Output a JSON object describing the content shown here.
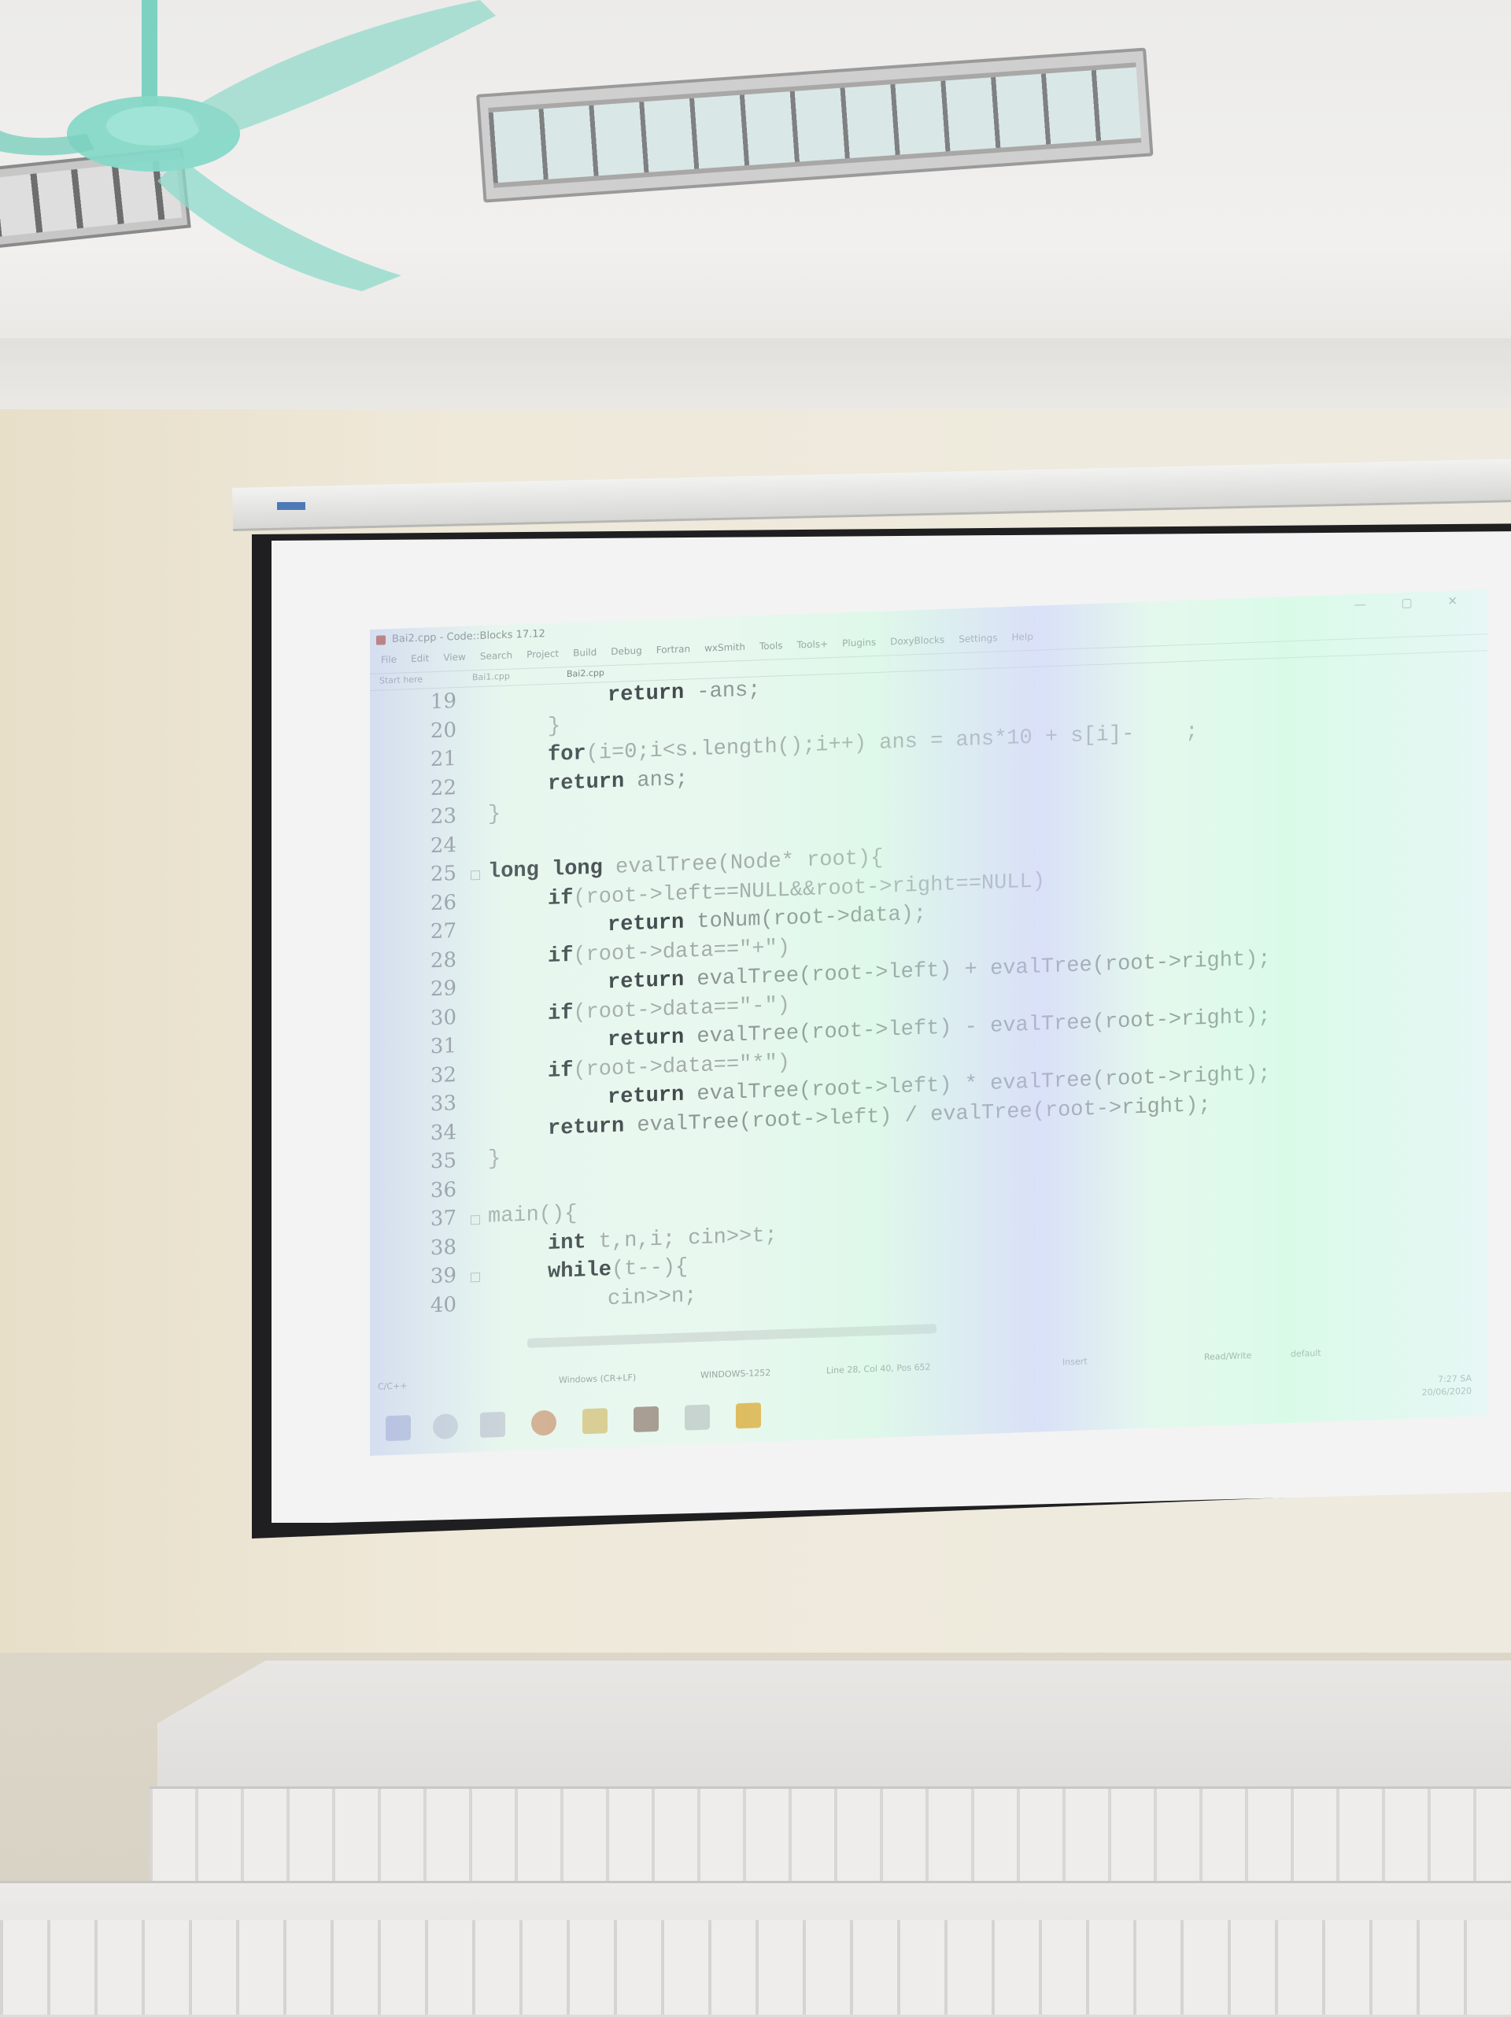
{
  "ide": {
    "window_title": "Bai2.cpp - Code::Blocks 17.12",
    "window_controls": "— ▢ ✕",
    "menu": [
      "File",
      "Edit",
      "View",
      "Search",
      "Project",
      "Build",
      "Debug",
      "Fortran",
      "wxSmith",
      "Tools",
      "Tools+",
      "Plugins",
      "DoxyBlocks",
      "Settings",
      "Help"
    ],
    "tabs": [
      "Start here",
      "Bai1.cpp",
      "Bai2.cpp"
    ],
    "code_lines": [
      {
        "n": "19",
        "indent": 2,
        "parts": [
          {
            "k": "kw",
            "t": "return"
          },
          {
            "k": "txt",
            "t": " -ans;"
          }
        ]
      },
      {
        "n": "20",
        "indent": 1,
        "parts": [
          {
            "k": "",
            "t": "}"
          }
        ]
      },
      {
        "n": "21",
        "indent": 1,
        "parts": [
          {
            "k": "kw",
            "t": "for"
          },
          {
            "k": "",
            "t": "(i=0;i<s.length();i++) ans = ans*10 + s[i]-    ;"
          }
        ]
      },
      {
        "n": "22",
        "indent": 1,
        "parts": [
          {
            "k": "kw",
            "t": "return"
          },
          {
            "k": "txt",
            "t": " ans;"
          }
        ]
      },
      {
        "n": "23",
        "indent": 0,
        "parts": [
          {
            "k": "",
            "t": "}"
          }
        ]
      },
      {
        "n": "24",
        "indent": 0,
        "parts": []
      },
      {
        "n": "25",
        "indent": 0,
        "parts": [
          {
            "k": "kw",
            "t": "long long"
          },
          {
            "k": "",
            "t": " evalTree(Node* root){"
          }
        ]
      },
      {
        "n": "26",
        "indent": 1,
        "parts": [
          {
            "k": "kw",
            "t": "if"
          },
          {
            "k": "",
            "t": "(root->left==NULL&&root->right==NULL)"
          }
        ]
      },
      {
        "n": "27",
        "indent": 2,
        "parts": [
          {
            "k": "kw",
            "t": "return"
          },
          {
            "k": "txt",
            "t": " toNum(root->data);"
          }
        ]
      },
      {
        "n": "28",
        "indent": 1,
        "parts": [
          {
            "k": "kw",
            "t": "if"
          },
          {
            "k": "",
            "t": "(root->data==\"+\")"
          }
        ]
      },
      {
        "n": "29",
        "indent": 2,
        "parts": [
          {
            "k": "kw",
            "t": "return"
          },
          {
            "k": "txt",
            "t": " evalTree(root->left) + evalTree(root->right);"
          }
        ]
      },
      {
        "n": "30",
        "indent": 1,
        "parts": [
          {
            "k": "kw",
            "t": "if"
          },
          {
            "k": "",
            "t": "(root->data==\"-\")"
          }
        ]
      },
      {
        "n": "31",
        "indent": 2,
        "parts": [
          {
            "k": "kw",
            "t": "return"
          },
          {
            "k": "txt",
            "t": " evalTree(root->left) - evalTree(root->right);"
          }
        ]
      },
      {
        "n": "32",
        "indent": 1,
        "parts": [
          {
            "k": "kw",
            "t": "if"
          },
          {
            "k": "",
            "t": "(root->data==\"*\")"
          }
        ]
      },
      {
        "n": "33",
        "indent": 2,
        "parts": [
          {
            "k": "kw",
            "t": "return"
          },
          {
            "k": "txt",
            "t": " evalTree(root->left) * evalTree(root->right);"
          }
        ]
      },
      {
        "n": "34",
        "indent": 1,
        "parts": [
          {
            "k": "kw",
            "t": "return"
          },
          {
            "k": "txt",
            "t": " evalTree(root->left) / evalTree(root->right);"
          }
        ]
      },
      {
        "n": "35",
        "indent": 0,
        "parts": [
          {
            "k": "",
            "t": "}"
          }
        ]
      },
      {
        "n": "36",
        "indent": 0,
        "parts": []
      },
      {
        "n": "37",
        "indent": 0,
        "parts": [
          {
            "k": "",
            "t": "main(){"
          }
        ]
      },
      {
        "n": "38",
        "indent": 1,
        "parts": [
          {
            "k": "kw",
            "t": "int"
          },
          {
            "k": "",
            "t": " t,n,i; cin>>t;"
          }
        ]
      },
      {
        "n": "39",
        "indent": 1,
        "parts": [
          {
            "k": "kw",
            "t": "while"
          },
          {
            "k": "",
            "t": "(t--){"
          }
        ]
      },
      {
        "n": "40",
        "indent": 2,
        "parts": [
          {
            "k": "",
            "t": "cin>>n;"
          }
        ]
      }
    ],
    "status": {
      "lang": "C/C++",
      "eol": "Windows (CR+LF)",
      "encoding": "WINDOWS-1252",
      "position": "Line 28, Col 40, Pos 652",
      "mode": "Insert",
      "access": "Read/Write",
      "profile": "default"
    },
    "tray": {
      "time": "7:27 SA",
      "date": "20/06/2020"
    }
  }
}
